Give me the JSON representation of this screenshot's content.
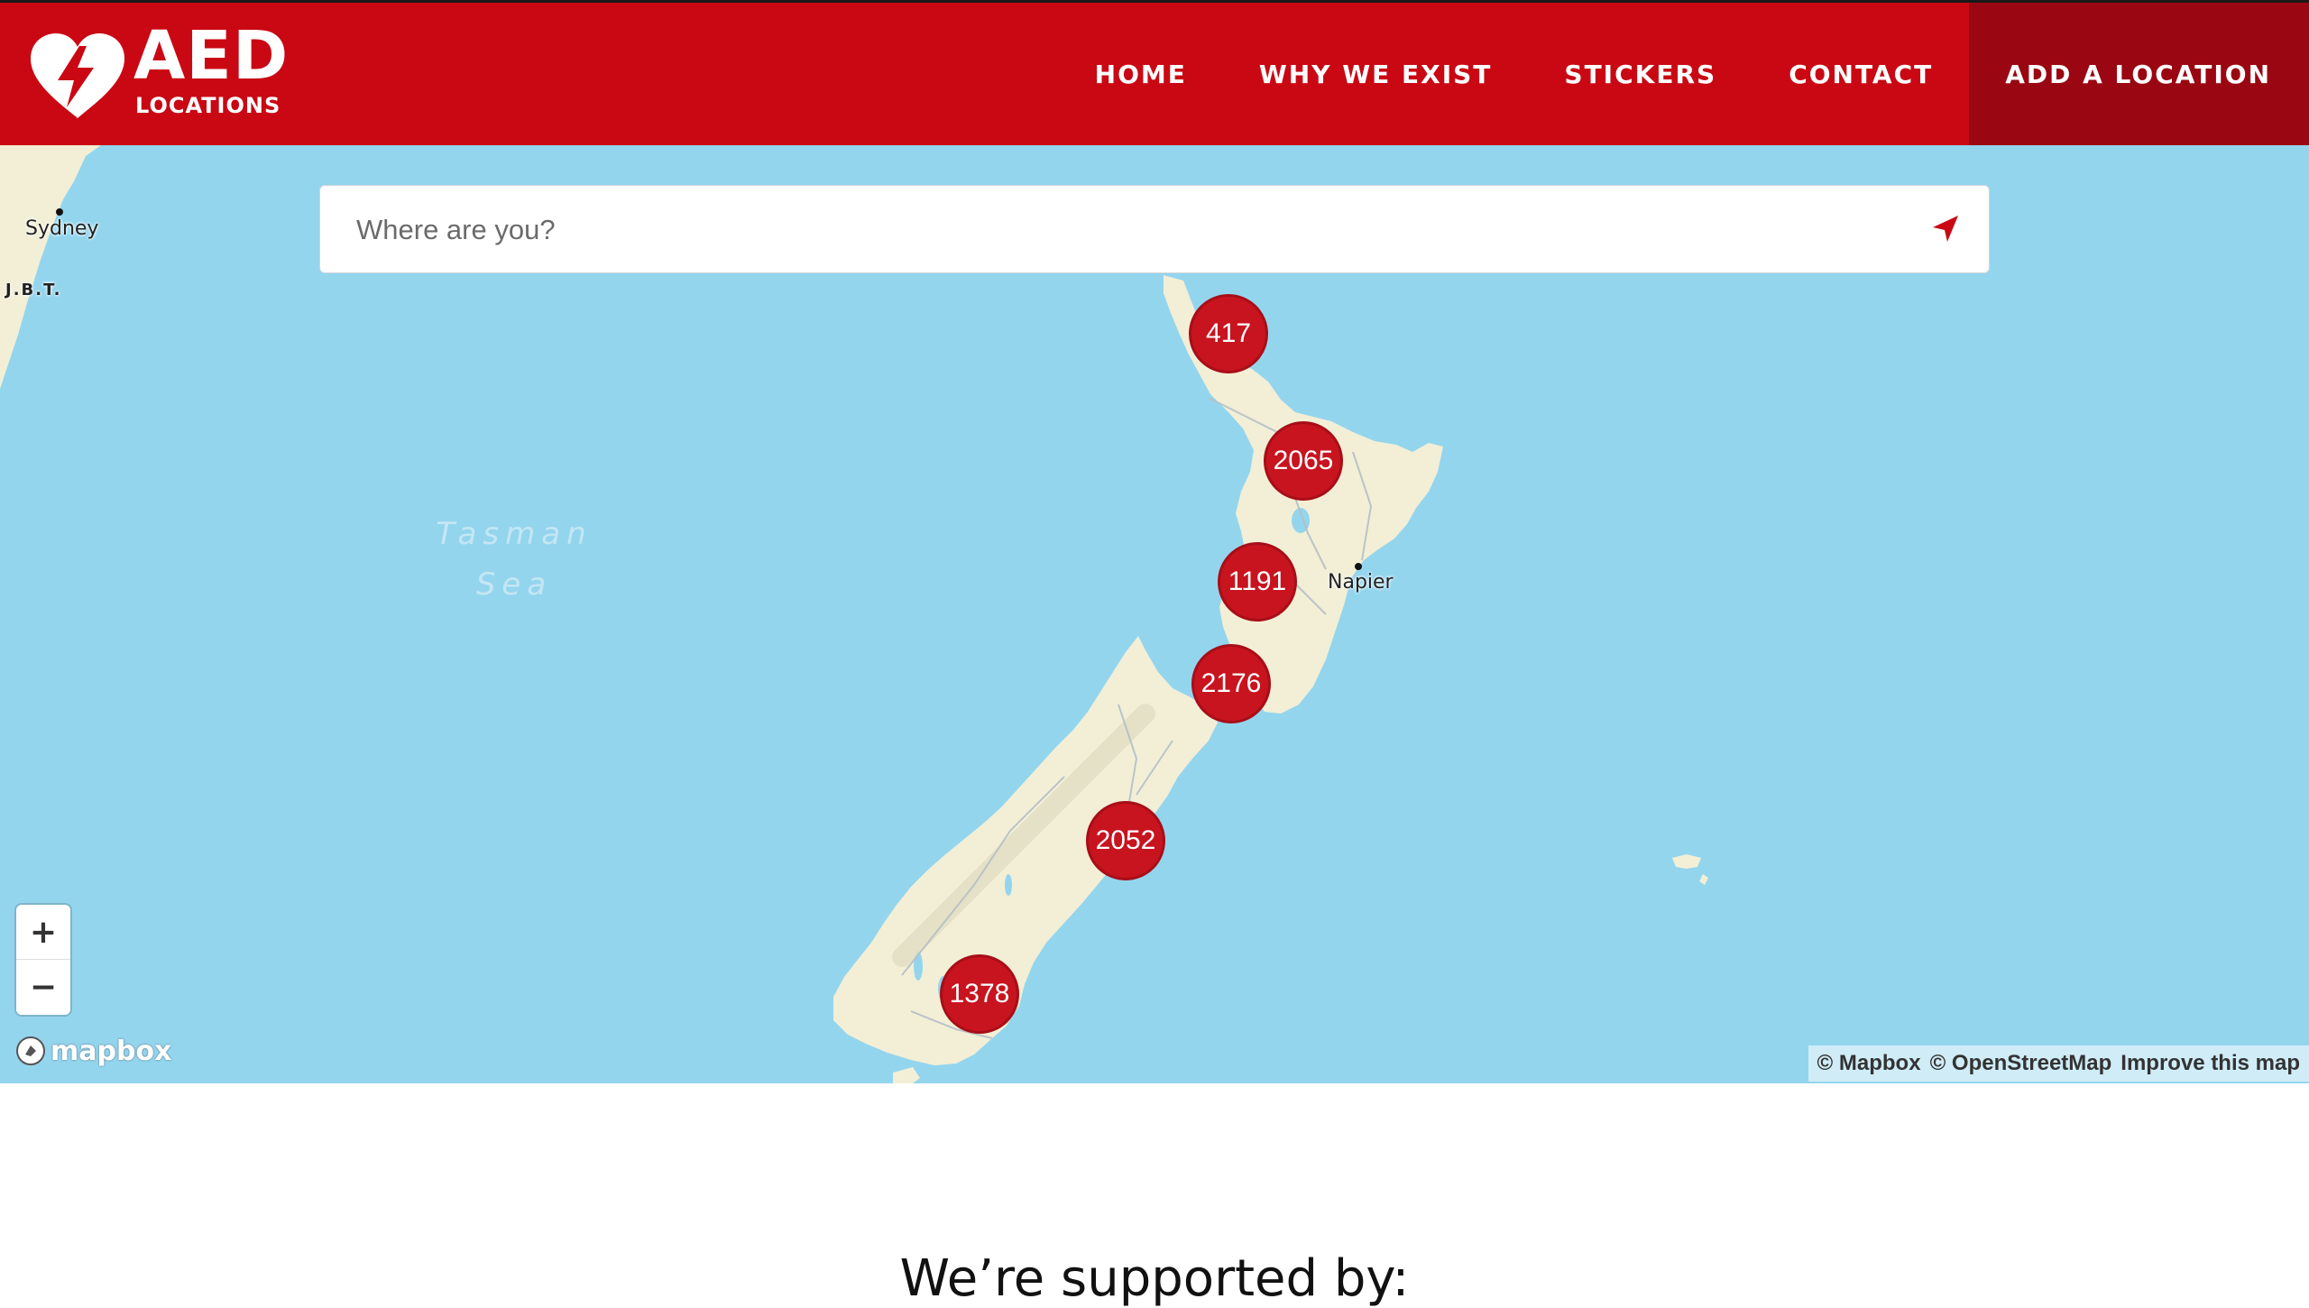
{
  "brand": {
    "name": "AED",
    "subtitle": "LOCATIONS"
  },
  "nav": {
    "items": [
      "HOME",
      "WHY WE EXIST",
      "STICKERS",
      "CONTACT"
    ],
    "cta": "ADD A LOCATION"
  },
  "search": {
    "placeholder": "Where are you?"
  },
  "map": {
    "places": {
      "sydney": "Sydney",
      "jbt": "J.B.T.",
      "napier": "Napier"
    },
    "sea": {
      "line1": "Tasman",
      "line2": "Sea"
    },
    "clusters": [
      "417",
      "2065",
      "1191",
      "2176",
      "2052",
      "1378"
    ],
    "zoom": {
      "in": "+",
      "out": "−"
    },
    "logo": "mapbox",
    "attribution": [
      "© Mapbox",
      "© OpenStreetMap",
      "Improve this map"
    ]
  },
  "colors": {
    "brand_red": "#c90814",
    "cta_red": "#9a0611",
    "water": "#94d5ee",
    "land": "#f2efd6",
    "cluster": "#c8141f"
  },
  "footer": {
    "heading": "We’re supported by:"
  }
}
